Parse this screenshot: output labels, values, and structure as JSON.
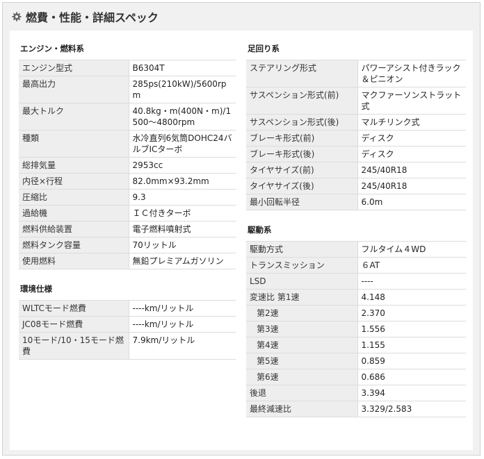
{
  "header": {
    "title": "燃費・性能・詳細スペック",
    "icon": "gear-icon"
  },
  "engine": {
    "title": "エンジン・燃料系",
    "rows": [
      {
        "k": "エンジン型式",
        "v": "B6304T"
      },
      {
        "k": "最高出力",
        "v": "285ps(210kW)/5600rpm"
      },
      {
        "k": "最大トルク",
        "v": "40.8kg・m(400N・m)/1500～4800rpm"
      },
      {
        "k": "種類",
        "v": "水冷直列6気筒DOHC24バルブICターボ"
      },
      {
        "k": "総排気量",
        "v": "2953cc"
      },
      {
        "k": "内径×行程",
        "v": "82.0mm×93.2mm"
      },
      {
        "k": "圧縮比",
        "v": "9.3"
      },
      {
        "k": "過給機",
        "v": "ＩＣ付きターボ"
      },
      {
        "k": "燃料供給装置",
        "v": "電子燃料噴射式"
      },
      {
        "k": "燃料タンク容量",
        "v": "70リットル"
      },
      {
        "k": "使用燃料",
        "v": "無鉛プレミアムガソリン"
      }
    ]
  },
  "environment": {
    "title": "環境仕様",
    "rows": [
      {
        "k": "WLTCモード燃費",
        "v": "----km/リットル"
      },
      {
        "k": "JC08モード燃費",
        "v": "----km/リットル"
      },
      {
        "k": "10モード/10・15モード燃費",
        "v": "7.9km/リットル"
      }
    ]
  },
  "suspension": {
    "title": "足回り系",
    "rows": [
      {
        "k": "ステアリング形式",
        "v": "パワーアシスト付きラック＆ピニオン"
      },
      {
        "k": "サスペンション形式(前)",
        "v": "マクファーソンストラット式"
      },
      {
        "k": "サスペンション形式(後)",
        "v": "マルチリンク式"
      },
      {
        "k": "ブレーキ形式(前)",
        "v": "ディスク"
      },
      {
        "k": "ブレーキ形式(後)",
        "v": "ディスク"
      },
      {
        "k": "タイヤサイズ(前)",
        "v": "245/40R18"
      },
      {
        "k": "タイヤサイズ(後)",
        "v": "245/40R18"
      },
      {
        "k": "最小回転半径",
        "v": "6.0m"
      }
    ]
  },
  "drivetrain": {
    "title": "駆動系",
    "rows": [
      {
        "k": "駆動方式",
        "v": "フルタイム４WD"
      },
      {
        "k": "トランスミッション",
        "v": "６AT"
      },
      {
        "k": "LSD",
        "v": "----"
      },
      {
        "k": "変速比 第1速",
        "v": "4.148"
      },
      {
        "k": "第2速",
        "v": "2.370"
      },
      {
        "k": "第3速",
        "v": "1.556"
      },
      {
        "k": "第4速",
        "v": "1.155"
      },
      {
        "k": "第5速",
        "v": "0.859"
      },
      {
        "k": "第6速",
        "v": "0.686"
      },
      {
        "k": "後退",
        "v": "3.394"
      },
      {
        "k": "最終減速比",
        "v": "3.329/2.583"
      }
    ]
  }
}
